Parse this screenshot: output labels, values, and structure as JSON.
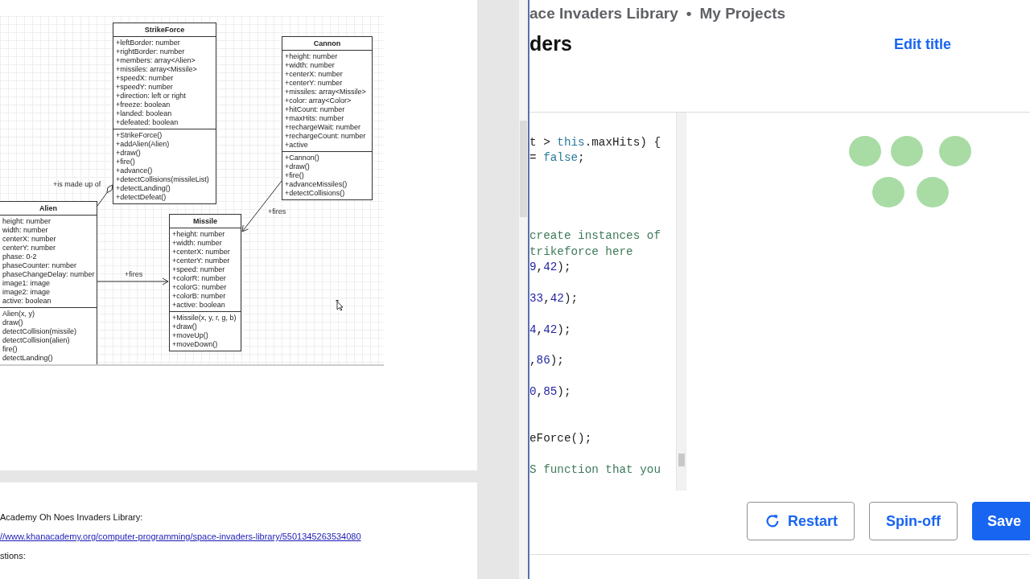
{
  "diagram": {
    "classes": [
      {
        "name": "StrikeForce",
        "attributes": [
          "+leftBorder: number",
          "+rightBorder: number",
          "+members: array<Alien>",
          "+missiles: array<Missile>",
          "+speedX: number",
          "+speedY: number",
          "+direction: left or right",
          "+freeze: boolean",
          "+landed: boolean",
          "+defeated: boolean"
        ],
        "methods": [
          "+StrikeForce()",
          "+addAlien(Alien)",
          "+draw()",
          "+fire()",
          "+advance()",
          "+detectCollisions(missileList)",
          "+detectLanding()",
          "+detectDefeat()"
        ]
      },
      {
        "name": "Cannon",
        "attributes": [
          "+height: number",
          "+width: number",
          "+centerX: number",
          "+centerY: number",
          "+missiles: array<Missile>",
          "+color: array<Color>",
          "+hitCount: number",
          "+maxHits: number",
          "+rechargeWait: number",
          "+rechargeCount: number",
          "+active"
        ],
        "methods": [
          "+Cannon()",
          "+draw()",
          "+fire()",
          "+advanceMissiles()",
          "+detectCollisions()"
        ]
      },
      {
        "name": "Alien",
        "attributes": [
          "height: number",
          "width: number",
          "centerX: number",
          "centerY: number",
          "phase: 0-2",
          "phaseCounter: number",
          "phaseChangeDelay: number",
          "image1: image",
          "image2: image",
          "active: boolean"
        ],
        "methods": [
          "Alien(x, y)",
          "draw()",
          "detectCollision(missile)",
          "detectCollision(alien)",
          "fire()",
          "detectLanding()"
        ]
      },
      {
        "name": "Missile",
        "attributes": [
          "+height: number",
          "+width: number",
          "+centerX: number",
          "+centerY: number",
          "+speed: number",
          "+colorR: number",
          "+colorG: number",
          "+colorB: number",
          "+active: boolean"
        ],
        "methods": [
          "+Missile(x, y, r, g, b)",
          "+draw()",
          "+moveUp()",
          "+moveDown()"
        ]
      }
    ],
    "relations": [
      {
        "kind": "aggregation",
        "label": "+is made up of"
      },
      {
        "kind": "arrow",
        "label": "+fires"
      },
      {
        "kind": "arrow",
        "label": "+fires"
      }
    ]
  },
  "document": {
    "lines": [
      {
        "kind": "text",
        "text": "Academy Oh Noes Invaders Library:"
      },
      {
        "kind": "link",
        "text": "//www.khanacademy.org/computer-programming/space-invaders-library/5501345263534080"
      },
      {
        "kind": "text",
        "text": "stions:"
      }
    ]
  },
  "project": {
    "breadcrumb": [
      "ace Invaders Library",
      "•",
      "My Projects"
    ],
    "title": "ders",
    "edit_title": "Edit title",
    "code": [
      {
        "kind": "code",
        "tokens": [
          {
            "kind": "plain",
            "text": "t > "
          },
          {
            "kind": "keyword",
            "text": "this"
          },
          {
            "kind": "plain",
            "text": ".maxHits) {"
          }
        ]
      },
      {
        "kind": "code",
        "tokens": [
          {
            "kind": "plain",
            "text": "= "
          },
          {
            "kind": "keyword",
            "text": "false"
          },
          {
            "kind": "plain",
            "text": ";"
          }
        ]
      },
      {
        "kind": "blank"
      },
      {
        "kind": "blank"
      },
      {
        "kind": "blank"
      },
      {
        "kind": "blank"
      },
      {
        "kind": "code",
        "tokens": [
          {
            "kind": "comment",
            "text": "create instances of"
          }
        ]
      },
      {
        "kind": "code",
        "tokens": [
          {
            "kind": "comment",
            "text": "trikeforce here"
          }
        ]
      },
      {
        "kind": "code",
        "tokens": [
          {
            "kind": "number",
            "text": "9"
          },
          {
            "kind": "plain",
            "text": ","
          },
          {
            "kind": "number",
            "text": "42"
          },
          {
            "kind": "plain",
            "text": ");"
          }
        ]
      },
      {
        "kind": "blank"
      },
      {
        "kind": "code",
        "tokens": [
          {
            "kind": "number",
            "text": "33"
          },
          {
            "kind": "plain",
            "text": ","
          },
          {
            "kind": "number",
            "text": "42"
          },
          {
            "kind": "plain",
            "text": ");"
          }
        ]
      },
      {
        "kind": "blank"
      },
      {
        "kind": "code",
        "tokens": [
          {
            "kind": "number",
            "text": "4"
          },
          {
            "kind": "plain",
            "text": ","
          },
          {
            "kind": "number",
            "text": "42"
          },
          {
            "kind": "plain",
            "text": ");"
          }
        ]
      },
      {
        "kind": "blank"
      },
      {
        "kind": "code",
        "tokens": [
          {
            "kind": "plain",
            "text": ","
          },
          {
            "kind": "number",
            "text": "86"
          },
          {
            "kind": "plain",
            "text": ");"
          }
        ]
      },
      {
        "kind": "blank"
      },
      {
        "kind": "code",
        "tokens": [
          {
            "kind": "number",
            "text": "0"
          },
          {
            "kind": "plain",
            "text": ","
          },
          {
            "kind": "number",
            "text": "85"
          },
          {
            "kind": "plain",
            "text": ");"
          }
        ]
      },
      {
        "kind": "blank"
      },
      {
        "kind": "blank"
      },
      {
        "kind": "code",
        "tokens": [
          {
            "kind": "plain",
            "text": "eForce();"
          }
        ]
      },
      {
        "kind": "blank"
      },
      {
        "kind": "code",
        "tokens": [
          {
            "kind": "comment",
            "text": "S function that you"
          }
        ]
      }
    ],
    "buttons": [
      {
        "kind": "outline",
        "label": "Restart"
      },
      {
        "kind": "outline",
        "label": "Spin-off"
      },
      {
        "kind": "solid",
        "label": "Save"
      }
    ]
  }
}
